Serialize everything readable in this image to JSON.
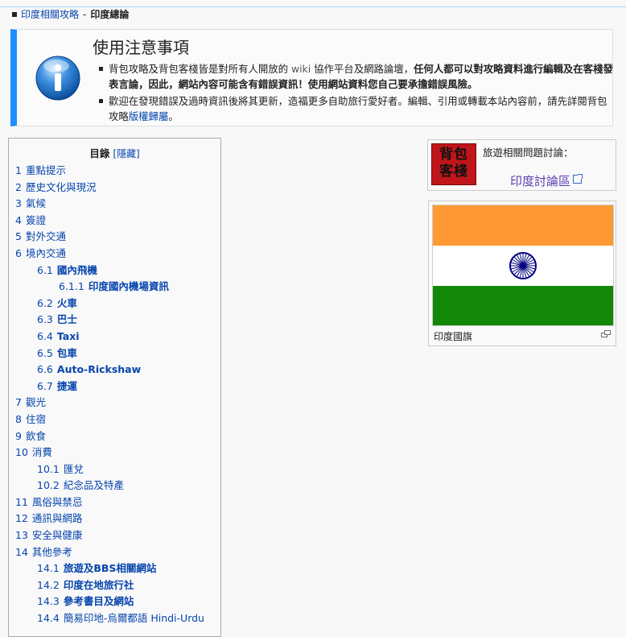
{
  "breadcrumb": {
    "parent": "印度相關攻略",
    "separator": "-",
    "current": "印度總論"
  },
  "notice": {
    "title": "使用注意事項",
    "item1_a": "背包攻略及背包客棧皆是對所有人開放的",
    "item1_wiki": "wiki",
    "item1_b": "協作平台及網路論壇，",
    "item1_bold": "任何人都可以對攻略資料進行編輯及在客棧發表言論，因此，網站內容可能含有錯誤資訊！使用網站資料您自己要承擔錯誤風險。",
    "item2_a": "歡迎在發現錯誤及過時資訊後將其更新，造福更多自助旅行愛好者。編輯、引用或轉載本站內容前，請先詳閱背包攻略",
    "item2_link": "版權歸屬",
    "item2_b": "。"
  },
  "toc": {
    "title": "目錄",
    "toggle": "[隱藏]",
    "items": [
      {
        "num": "1",
        "label": "重點提示",
        "level": 1
      },
      {
        "num": "2",
        "label": "歷史文化與現況",
        "level": 1
      },
      {
        "num": "3",
        "label": "氣候",
        "level": 1
      },
      {
        "num": "4",
        "label": "簽證",
        "level": 1
      },
      {
        "num": "5",
        "label": "對外交通",
        "level": 1
      },
      {
        "num": "6",
        "label": "境內交通",
        "level": 1
      },
      {
        "num": "6.1",
        "label": "國內飛機",
        "level": 2
      },
      {
        "num": "6.1.1",
        "label": "印度國內機場資訊",
        "level": 3
      },
      {
        "num": "6.2",
        "label": "火車",
        "level": 2
      },
      {
        "num": "6.3",
        "label": "巴士",
        "level": 2
      },
      {
        "num": "6.4",
        "label": "Taxi",
        "level": 2
      },
      {
        "num": "6.5",
        "label": "包車",
        "level": 2
      },
      {
        "num": "6.6",
        "label": "Auto-Rickshaw",
        "level": 2
      },
      {
        "num": "6.7",
        "label": "捷運",
        "level": 2
      },
      {
        "num": "7",
        "label": "觀光",
        "level": 1
      },
      {
        "num": "8",
        "label": "住宿",
        "level": 1
      },
      {
        "num": "9",
        "label": "飲食",
        "level": 1
      },
      {
        "num": "10",
        "label": "消費",
        "level": 1
      },
      {
        "num": "10.1",
        "label": "匯兌",
        "level": 2
      },
      {
        "num": "10.2",
        "label": "紀念品及特產",
        "level": 2
      },
      {
        "num": "11",
        "label": "風俗與禁忌",
        "level": 1
      },
      {
        "num": "12",
        "label": "通訊與網路",
        "level": 1
      },
      {
        "num": "13",
        "label": "安全與健康",
        "level": 1
      },
      {
        "num": "14",
        "label": "其他參考",
        "level": 1
      },
      {
        "num": "14.1",
        "label": "旅遊及BBS相關網站",
        "level": 2
      },
      {
        "num": "14.2",
        "label": "印度在地旅行社",
        "level": 2
      },
      {
        "num": "14.3",
        "label": "參考書目及網站",
        "level": 2
      },
      {
        "num": "14.4",
        "label": "簡易印地-烏爾都語 Hindi-Urdu",
        "level": 2
      }
    ]
  },
  "discussion": {
    "logo_line1": "背包",
    "logo_line2": "客棧",
    "label": "旅遊相關問題討論：",
    "forum_link": "印度討論區"
  },
  "flag": {
    "caption": "印度國旗",
    "colors": {
      "saffron": "#ff9933",
      "white": "#ffffff",
      "green": "#138808",
      "chakra": "#000080"
    }
  },
  "colors": {
    "link": "#0645ad",
    "accent": "#1e90ff"
  }
}
